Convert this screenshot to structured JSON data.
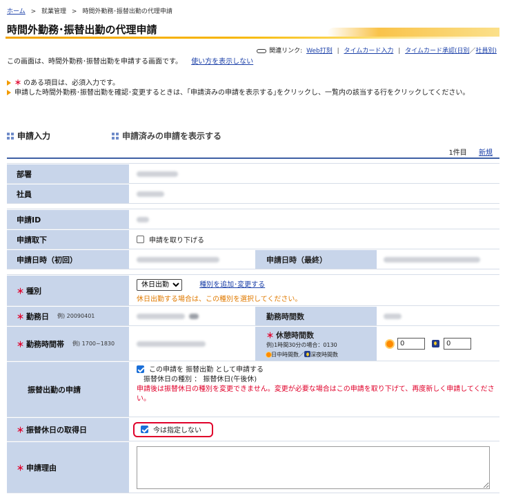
{
  "breadcrumb": {
    "home": "ホーム",
    "sep": ">",
    "level2": "就業管理",
    "level3": "時間外勤務･振替出勤の代理申請"
  },
  "page_title": "時間外勤務･振替出勤の代理申請",
  "related": {
    "label": "関連リンク:",
    "web_punch": "Web打刻",
    "timecard_input": "タイムカード入力",
    "timecard_approve": "タイムカード承認(日別",
    "slash": "／",
    "timecard_approve_2": "社員別)"
  },
  "description": {
    "text": "この画面は、時間外勤務･振替出勤を申請する画面です。",
    "hide_howto": "使い方を表示しない"
  },
  "notes": {
    "required_mark": "＊",
    "required": "のある項目は、必須入力です。",
    "hint": "申請した時間外勤務･振替出勤を確認･変更するときは、｢申請済みの申請を表示する｣をクリックし、一覧内の該当する行をクリックしてください。"
  },
  "sections": {
    "input": "申請入力",
    "view_submitted": "申請済みの申請を表示する"
  },
  "pager": {
    "count": "1件目",
    "new": "新規"
  },
  "form": {
    "department_label": "部署",
    "employee_label": "社員",
    "request_id_label": "申請ID",
    "withdraw_label": "申請取下",
    "withdraw_checkbox": "申請を取り下げる",
    "date_first_label": "申請日時（初回）",
    "date_last_label": "申請日時（最終）",
    "type_label": "種別",
    "type_selected": "休日出勤",
    "type_edit_link": "種別を追加･変更する",
    "type_note": "休日出勤する場合は、この種別を選択してください。",
    "workday_label": "勤務日",
    "workday_example": "例) 20090401",
    "work_hours_label": "勤務時間数",
    "work_time_label": "勤務時間帯",
    "work_time_example": "例) 1700~1830",
    "break_label": "休憩時間数",
    "break_example": "例)1時間30分の場合：0130",
    "break_legend_day": "日中時間数",
    "break_legend_sep": "／",
    "break_legend_night": "深夜時間数",
    "break_day_value": "0",
    "break_night_value": "0",
    "substitute_label": "振替出勤の申請",
    "substitute_checkbox": "この申請を 振替出勤 として申請する",
    "substitute_kind": "振替休日の種別 ： 振替休日(午後休)",
    "substitute_warning": "申請後は振替休日の種別を変更できません。変更が必要な場合はこの申請を取り下げて、再度新しく申請してください。",
    "holiday_date_label": "振替休日の取得日",
    "holiday_date_checkbox": "今は指定しない",
    "reason_label": "申請理由",
    "required_mark": "＊"
  },
  "colors": {
    "label_bg": "#c8d5ea",
    "accent_orange": "#f2a400",
    "required_red": "#e0002a",
    "link_blue": "#1a3fa8"
  }
}
